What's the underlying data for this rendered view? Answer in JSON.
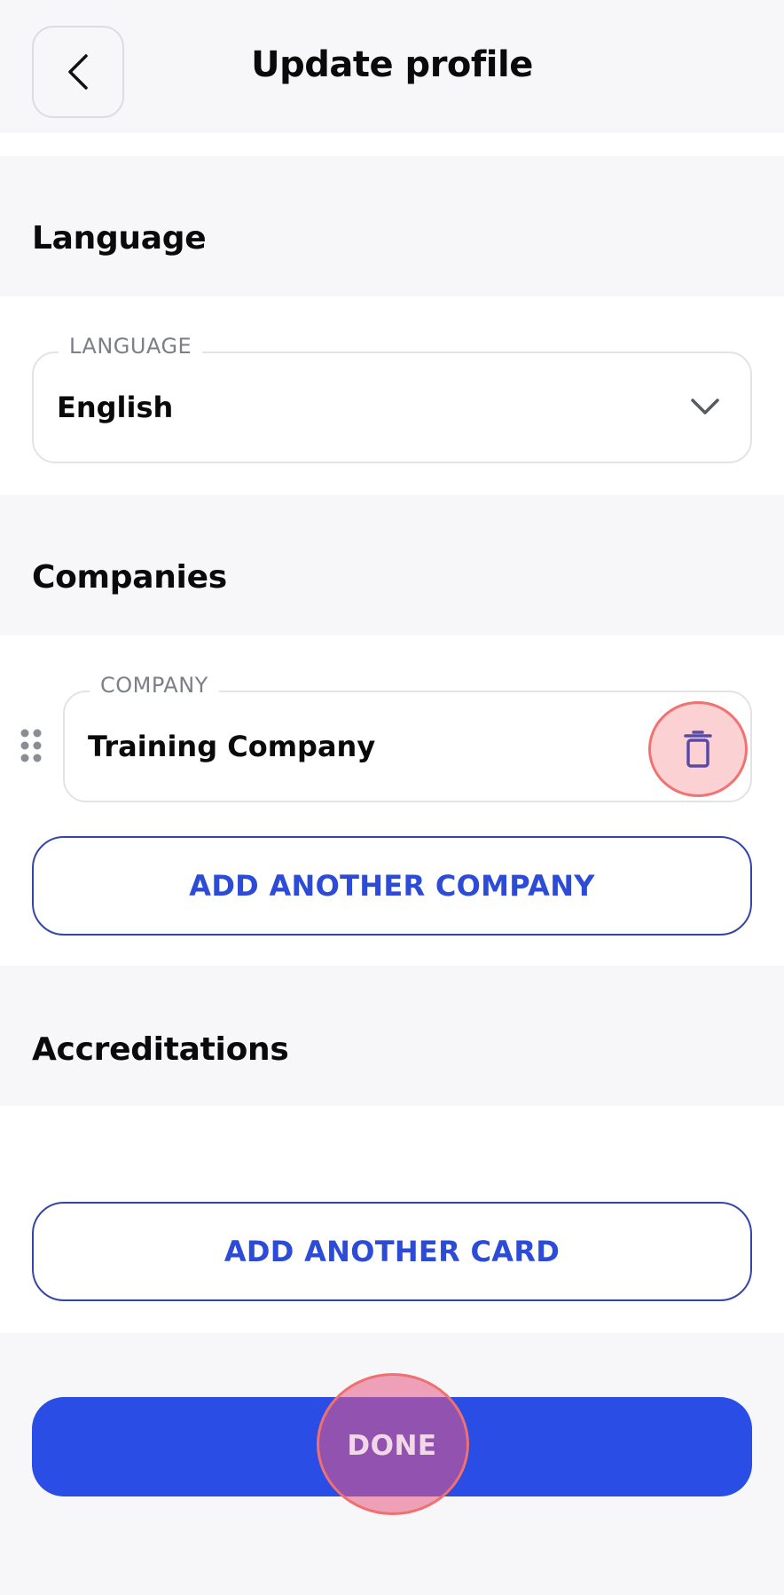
{
  "header": {
    "title": "Update profile",
    "back_icon": "chevron-left-icon"
  },
  "language_section": {
    "heading": "Language",
    "field_label": "LANGUAGE",
    "value": "English",
    "dropdown_icon": "chevron-down-icon"
  },
  "companies_section": {
    "heading": "Companies",
    "field_label": "COMPANY",
    "value": "Training Company",
    "drag_icon": "drag-handle-icon",
    "delete_icon": "trash-icon",
    "add_button": "ADD ANOTHER COMPANY"
  },
  "accreditations_section": {
    "heading": "Accreditations",
    "add_button": "ADD ANOTHER CARD"
  },
  "footer": {
    "done_label": "DONE"
  },
  "colors": {
    "primary": "#2a4de6",
    "outline": "#3346a8",
    "highlight": "#f27171",
    "background": "#f7f7f9"
  }
}
